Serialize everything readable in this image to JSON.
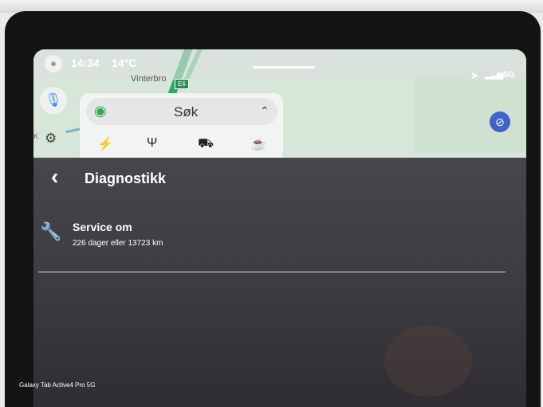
{
  "status_bar": {
    "time": "14:34",
    "temperature": "14°C",
    "network": "5G"
  },
  "map": {
    "place_label": "Vinterbro",
    "road_shield": "E6",
    "scale_label": "1K"
  },
  "search": {
    "label": "Søk",
    "icon": "maps-pin-icon"
  },
  "categories": [
    {
      "icon": "charging-icon",
      "glyph": "⚡"
    },
    {
      "icon": "restaurant-icon",
      "glyph": "Ψ"
    },
    {
      "icon": "shopping-cart-icon",
      "glyph": "⛟"
    },
    {
      "icon": "coffee-icon",
      "glyph": "☕"
    }
  ],
  "diagnostics": {
    "title": "Diagnostikk",
    "service_title": "Service om",
    "service_detail": "226 dager eller 13723 km"
  },
  "device_label": "Galaxy Tab Active4 Pro 5G",
  "colors": {
    "panel_bg": "#3d3c41",
    "map_green": "#2ea86b",
    "compass_blue": "#3f63c8"
  }
}
